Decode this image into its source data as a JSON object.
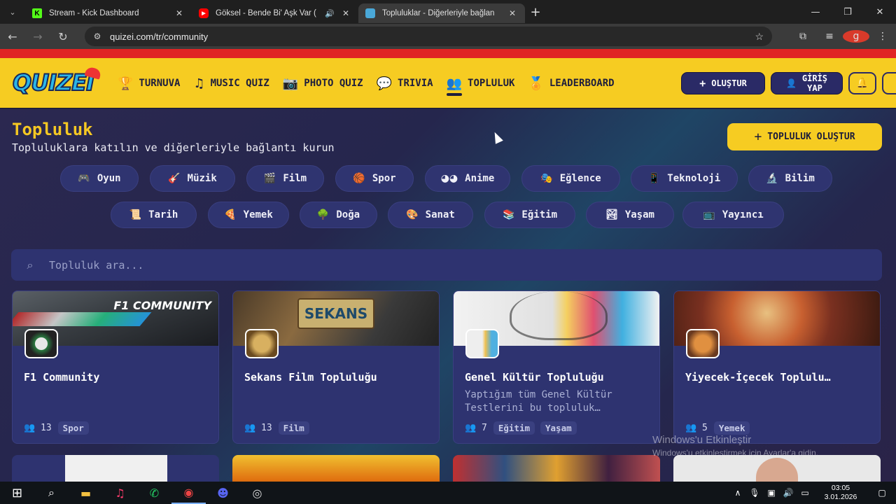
{
  "browser": {
    "tabs": [
      {
        "title": "Stream - Kick Dashboard",
        "icon": "kick-icon"
      },
      {
        "title": "Göksel - Bende Bi' Aşk Var (",
        "icon": "youtube-icon"
      },
      {
        "title": "Topluluklar - Diğerleriyle bağlan",
        "icon": "quizei-icon"
      }
    ],
    "url": "quizei.com/tr/community",
    "profile_initial": "g"
  },
  "site": {
    "logo": "QUIZEI",
    "nav": [
      {
        "label": "TURNUVA",
        "icon": "trophy-icon"
      },
      {
        "label": "MUSIC QUIZ",
        "icon": "music-note-icon"
      },
      {
        "label": "PHOTO QUIZ",
        "icon": "camera-icon"
      },
      {
        "label": "TRIVIA",
        "icon": "speech-bubble-icon"
      },
      {
        "label": "TOPLULUK",
        "icon": "people-icon"
      },
      {
        "label": "LEADERBOARD",
        "icon": "medal-icon"
      }
    ],
    "create_label": "OLUŞTUR",
    "login_label_1": "GİRİŞ",
    "login_label_2": "YAP"
  },
  "page": {
    "title": "Topluluk",
    "subtitle": "Topluluklara katılın ve diğerleriyle bağlantı kurun",
    "create_community": "TOPLULUK OLUŞTUR",
    "search_placeholder": "Topluluk ara...",
    "categories_row1": [
      "Oyun",
      "Müzik",
      "Film",
      "Spor",
      "Anime",
      "Eğlence",
      "Teknoloji",
      "Bilim"
    ],
    "categories_row2": [
      "Tarih",
      "Yemek",
      "Doğa",
      "Sanat",
      "Eğitim",
      "Yaşam",
      "Yayıncı"
    ]
  },
  "communities": [
    {
      "name": "F1 Community",
      "description": "",
      "members": "13",
      "tags": [
        "Spor"
      ],
      "banner_text": "F1 COMMUNITY"
    },
    {
      "name": "Sekans Film Topluluğu",
      "description": "",
      "members": "13",
      "tags": [
        "Film"
      ],
      "banner_text": "SEKANS"
    },
    {
      "name": "Genel Kültür Topluluğu",
      "description": "Yaptığım tüm Genel Kültür Testlerini bu topluluk…",
      "members": "7",
      "tags": [
        "Eğitim",
        "Yaşam"
      ],
      "banner_text": ""
    },
    {
      "name": "Yiyecek-İçecek Toplulu…",
      "description": "",
      "members": "5",
      "tags": [
        "Yemek"
      ],
      "banner_text": ""
    }
  ],
  "watermark": {
    "line1": "Windows'u Etkinleştir",
    "line2": "Windows'u etkinleştirmek için Ayarlar'a gidin."
  },
  "taskbar": {
    "time": "03:05",
    "date": "3.01.2026"
  },
  "colors": {
    "accent_yellow": "#f6cc22",
    "navy": "#2a2a66",
    "card_bg": "#2e3370"
  }
}
